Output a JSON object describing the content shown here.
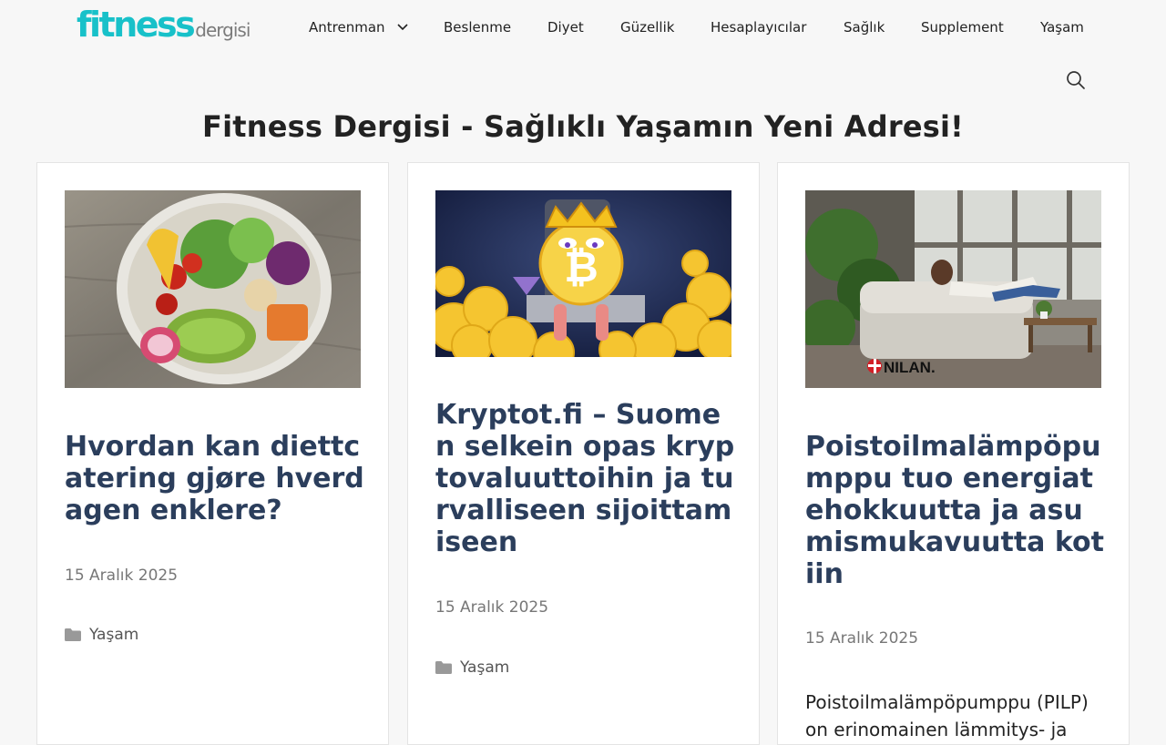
{
  "logo": {
    "main": "fitness",
    "sub": "dergisi"
  },
  "nav": {
    "items": [
      "Antrenman",
      "Beslenme",
      "Diyet",
      "Güzellik",
      "Hesaplayıcılar",
      "Sağlık",
      "Supplement",
      "Yaşam"
    ],
    "search_icon": "search-icon"
  },
  "page": {
    "title": "Fitness Dergisi - Sağlıklı Yaşamın Yeni Adresi!"
  },
  "posts": [
    {
      "title": "Hvordan kan diettcatering gjøre hverdagen enklere?",
      "date": "15 Aralık 2025",
      "category": "Yaşam",
      "image": "salad-bowl-image"
    },
    {
      "title": "Kryptot.fi – Suomen selkein opas kryptovaluuttoihin ja turvalliseen sijoittamiseen",
      "date": "15 Aralık 2025",
      "category": "Yaşam",
      "image": "bitcoin-king-image"
    },
    {
      "title": "Poistoilmalämpöpumppu tuo energiatehokkuutta ja asumismukavuutta kotiin",
      "date": "15 Aralık 2025",
      "excerpt": "Poistoilmalämpöpumppu (PILP) on erinomainen lämmitys- ja",
      "image": "living-room-image",
      "image_brand": "NILAN."
    }
  ],
  "colors": {
    "brand": "#18c1c9",
    "post_title": "#2b3e5c",
    "background": "#f7f7f7"
  }
}
